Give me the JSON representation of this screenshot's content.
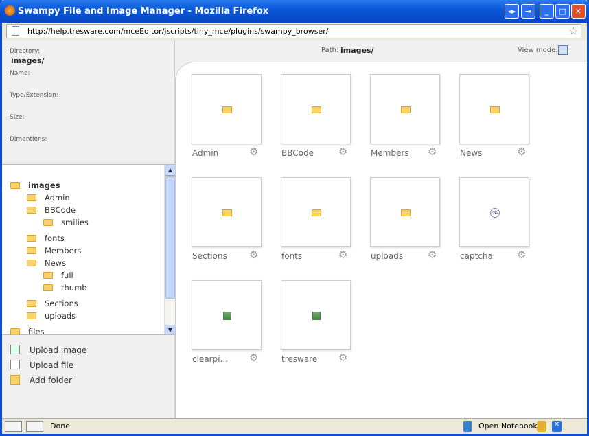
{
  "window": {
    "title": "Swampy File and Image Manager - Mozilla Firefox",
    "url": "http://help.tresware.com/mceEditor/jscripts/tiny_mce/plugins/swampy_browser/"
  },
  "info": {
    "directory_label": "Directory:",
    "directory_value": "images/",
    "name_label": "Name:",
    "type_label": "Type/Extension:",
    "size_label": "Size:",
    "dimensions_label": "Dimentions:"
  },
  "header": {
    "path_label": "Path:",
    "path_value": "images/",
    "view_mode_label": "View mode:"
  },
  "tree": [
    {
      "label": "images",
      "level": 0,
      "bold": true
    },
    {
      "label": "Admin",
      "level": 1
    },
    {
      "label": "BBCode",
      "level": 1
    },
    {
      "label": "smilies",
      "level": 2
    },
    {
      "label": "fonts",
      "level": 1
    },
    {
      "label": "Members",
      "level": 1
    },
    {
      "label": "News",
      "level": 1
    },
    {
      "label": "full",
      "level": 2
    },
    {
      "label": "thumb",
      "level": 2
    },
    {
      "label": "Sections",
      "level": 1
    },
    {
      "label": "uploads",
      "level": 1
    },
    {
      "label": "files",
      "level": 0
    }
  ],
  "actions": {
    "upload_image": "Upload image",
    "upload_file": "Upload file",
    "add_folder": "Add folder"
  },
  "items": [
    {
      "label": "Admin",
      "type": "folder"
    },
    {
      "label": "BBCode",
      "type": "folder"
    },
    {
      "label": "Members",
      "type": "folder"
    },
    {
      "label": "News",
      "type": "folder"
    },
    {
      "label": "Sections",
      "type": "folder"
    },
    {
      "label": "fonts",
      "type": "folder"
    },
    {
      "label": "uploads",
      "type": "folder"
    },
    {
      "label": "captcha",
      "type": "png"
    },
    {
      "label": "clearpi...",
      "type": "image"
    },
    {
      "label": "tresware",
      "type": "image"
    }
  ],
  "statusbar": {
    "status": "Done",
    "notebook": "Open Notebook"
  }
}
